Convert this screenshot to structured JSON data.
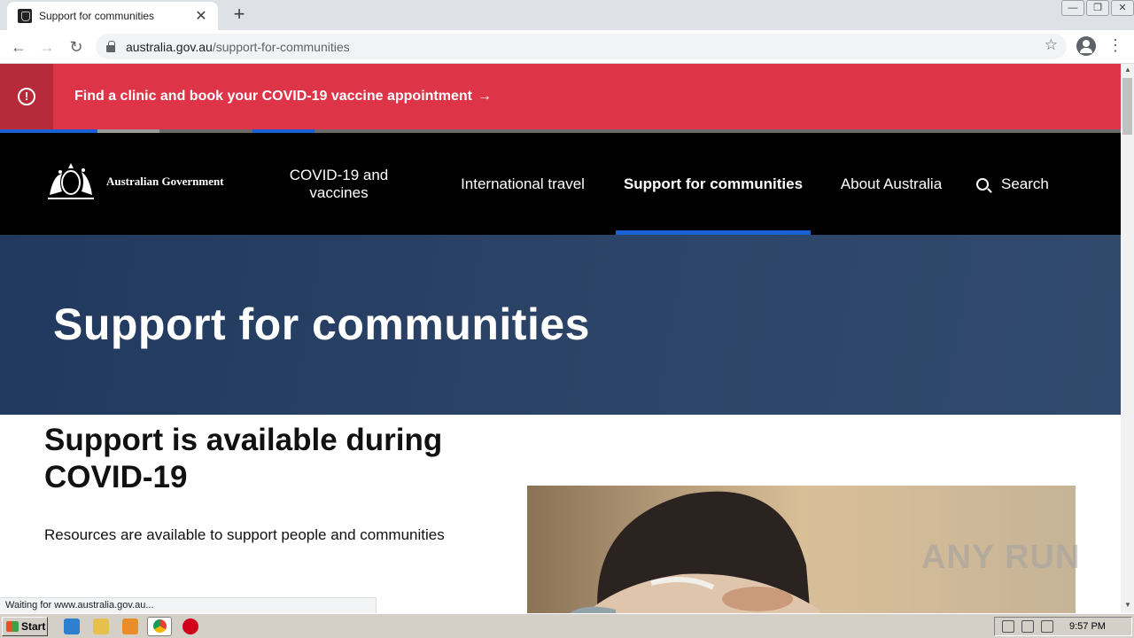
{
  "browser": {
    "tab_title": "Support for communities",
    "tab_close": "✕",
    "new_tab": "+",
    "url_host": "australia.gov.au",
    "url_path": "/support-for-communities",
    "back": "←",
    "forward": "→",
    "reload": "↻",
    "bookmark": "☆",
    "menu": "⋮",
    "minimize": "—",
    "restore": "❐",
    "close": "✕",
    "status_text": "Waiting for www.australia.gov.au..."
  },
  "alert": {
    "icon": "!",
    "text": "Find a clinic and book your COVID-19 vaccine appointment",
    "arrow": "→"
  },
  "header": {
    "logo_text": "Australian Government",
    "nav": [
      {
        "label": "COVID-19 and vaccines",
        "active": false
      },
      {
        "label": "International travel",
        "active": false
      },
      {
        "label": "Support for communities",
        "active": true
      },
      {
        "label": "About Australia",
        "active": false
      }
    ],
    "search_label": "Search"
  },
  "colors": {
    "alert_bg": "#dd3447",
    "nav_bg": "#000000",
    "active_underline": "#1a62d4",
    "hero_bg": "#2c4467",
    "stripe": [
      "#1a62d4",
      "#6b6b6b",
      "#9a9a9a",
      "#1a62d4"
    ]
  },
  "hero": {
    "title": "Support for communities"
  },
  "main": {
    "heading": "Support is available during COVID-19",
    "intro": "Resources are available to support people and communities"
  },
  "overlay": {
    "watermark": "ANY RUN"
  },
  "taskbar": {
    "start_label": "Start",
    "clock": "9:57 PM"
  }
}
